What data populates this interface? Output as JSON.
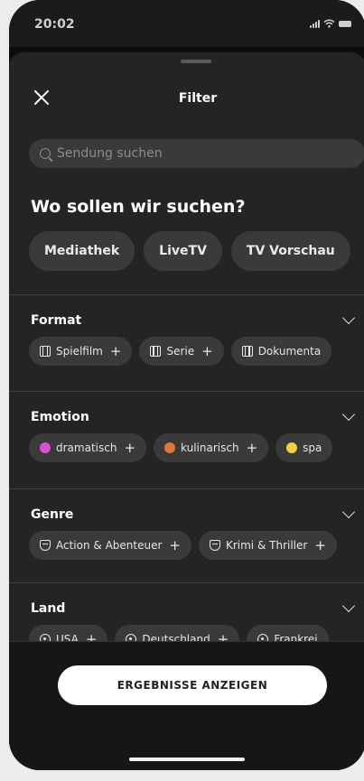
{
  "status_bar": {
    "time": "20:02"
  },
  "sheet": {
    "title": "Filter"
  },
  "search": {
    "placeholder": "Sendung suchen"
  },
  "where": {
    "heading": "Wo sollen wir suchen?",
    "options": [
      "Mediathek",
      "LiveTV",
      "TV Vorschau"
    ]
  },
  "sections": [
    {
      "title": "Format",
      "chips": [
        {
          "label": "Spielfilm",
          "icon": "film-icon"
        },
        {
          "label": "Serie",
          "icon": "film-icon"
        },
        {
          "label": "Dokumenta",
          "icon": "film-icon"
        }
      ]
    },
    {
      "title": "Emotion",
      "chips": [
        {
          "label": "dramatisch",
          "icon": "dot-icon",
          "color": "#d94fd0"
        },
        {
          "label": "kulinarisch",
          "icon": "dot-icon",
          "color": "#e0773a"
        },
        {
          "label": "spa",
          "icon": "dot-icon",
          "color": "#f2d13a"
        }
      ]
    },
    {
      "title": "Genre",
      "chips": [
        {
          "label": "Action & Abenteuer",
          "icon": "mask-icon"
        },
        {
          "label": "Krimi & Thriller",
          "icon": "mask-icon"
        }
      ]
    },
    {
      "title": "Land",
      "chips": [
        {
          "label": "USA",
          "icon": "pin-icon"
        },
        {
          "label": "Deutschland",
          "icon": "pin-icon"
        },
        {
          "label": "Frankrei",
          "icon": "pin-icon"
        }
      ]
    }
  ],
  "chip_add_symbol": "+",
  "footer": {
    "cta_label": "ERGEBNISSE ANZEIGEN"
  }
}
